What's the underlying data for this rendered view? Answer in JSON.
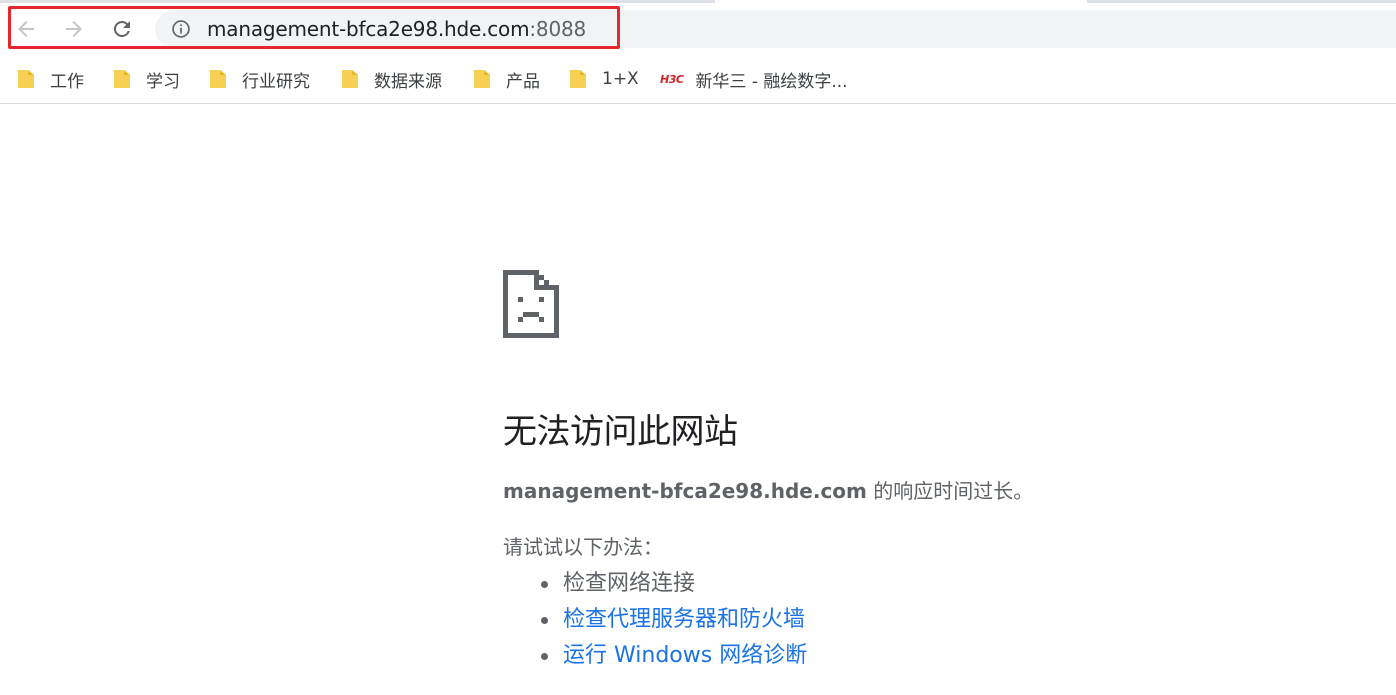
{
  "browser": {
    "address_bar": {
      "host": "management-bfca2e98.hde.com",
      "port": ":8088"
    },
    "nav_icons": [
      "back-icon",
      "forward-icon",
      "reload-icon",
      "info-icon"
    ],
    "highlight_color": "#e8262b",
    "bookmarks": [
      {
        "label": "工作",
        "icon": "folder-icon"
      },
      {
        "label": "学习",
        "icon": "folder-icon"
      },
      {
        "label": "行业研究",
        "icon": "folder-icon"
      },
      {
        "label": "数据来源",
        "icon": "folder-icon"
      },
      {
        "label": "产品",
        "icon": "folder-icon"
      },
      {
        "label": "1+X",
        "icon": "folder-icon"
      },
      {
        "label": "新华三 - 融绘数字...",
        "icon": "h3c-logo",
        "logo_text": "H3C"
      }
    ]
  },
  "error_page": {
    "icon": "sad-page-icon",
    "title": "无法访问此网站",
    "description_host": "management-bfca2e98.hde.com",
    "description_suffix": " 的响应时间过长。",
    "suggestions_label": "请试试以下办法：",
    "suggestions": [
      {
        "text": "检查网络连接",
        "is_link": false
      },
      {
        "text": "检查代理服务器和防火墙",
        "is_link": true
      },
      {
        "text": "运行 Windows 网络诊断",
        "is_link": true
      }
    ],
    "link_color": "#1a73e8"
  }
}
